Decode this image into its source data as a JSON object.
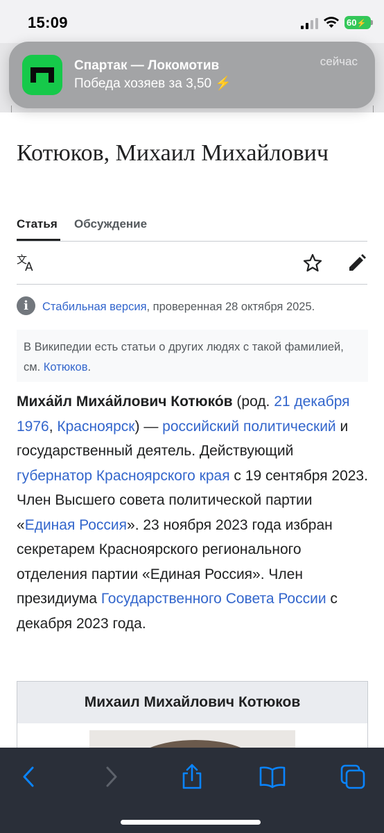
{
  "status_bar": {
    "time": "15:09",
    "battery": "60"
  },
  "notification": {
    "app_icon": "sports-app-icon",
    "title": "Спартак — Локомотив",
    "body": "Победа хозяев за 3,50 ⚡",
    "time": "сейчас"
  },
  "article": {
    "title": "Котюков, Михаил Михайлович",
    "tabs": [
      {
        "label": "Статья",
        "active": true
      },
      {
        "label": "Обсуждение",
        "active": false
      }
    ],
    "actions": {
      "language_icon": "language-icon",
      "watch_icon": "star-icon",
      "edit_icon": "pencil-icon"
    },
    "flagged": {
      "link": "Стабильная версия",
      "rest": ", проверенная 28 октября 2025."
    },
    "hatnote": {
      "text": "В Википедии есть статьи о других людях с такой фамилией, см. ",
      "link": "Котюков",
      "end": "."
    },
    "lead": {
      "name": "Миха́йл Миха́йлович Котюко́в",
      "p1": " (род. ",
      "link_birth": "21 декабря 1976",
      "p2": ", ",
      "link_city": "Красноярск",
      "p3": ") — ",
      "link_politician": "российский политический",
      "p4": " и государственный деятель. Действующий ",
      "link_governor": "губернатор Красноярского края",
      "p5": " с 19 сентября 2023. Член Высшего совета политической партии «",
      "link_party": "Единая Россия",
      "p6": "». 23 ноября 2023 года избран секретарем Красноярского регионального отделения партии «Единая Россия». Член президиума ",
      "link_council": "Государственного Совета России",
      "p7": " с декабря 2023 года."
    },
    "infobox": {
      "title": "Михаил Михайлович Котюков"
    }
  },
  "toolbar": {
    "back_icon": "back-chevron-icon",
    "forward_icon": "forward-chevron-icon",
    "share_icon": "share-icon",
    "bookmarks_icon": "book-icon",
    "tabs_icon": "tabs-icon"
  },
  "colors": {
    "link": "#3366cc",
    "text": "#202122",
    "toolbar_bg": "#2a2f39",
    "toolbar_icon": "#0a84ff",
    "battery": "#34c759",
    "app_icon": "#16c94a"
  }
}
